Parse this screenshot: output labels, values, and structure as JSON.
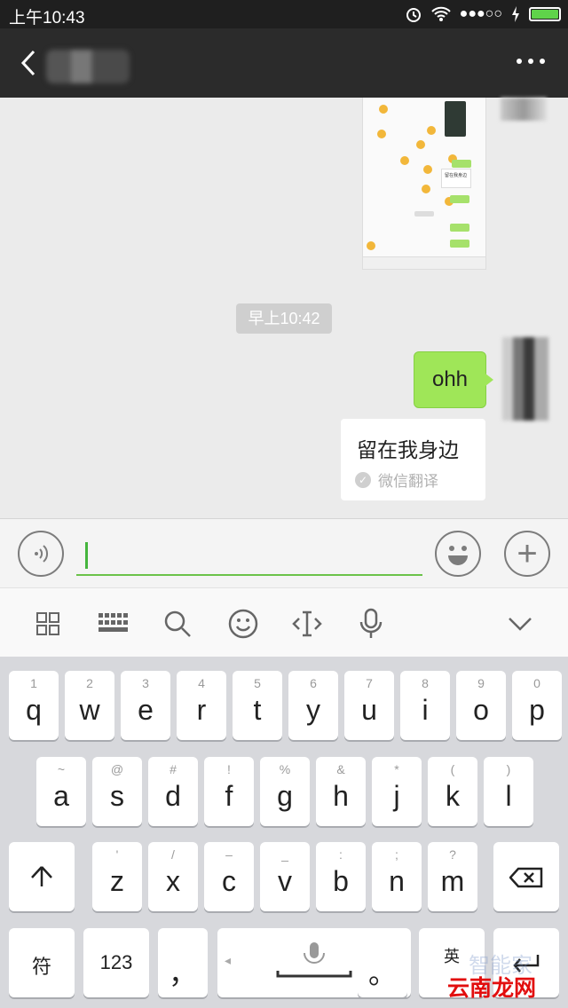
{
  "status_bar": {
    "time": "上午10:43",
    "signal": "●●●○○"
  },
  "nav": {
    "title": ""
  },
  "chat": {
    "timestamp": "早上10:42",
    "sent_message": "ohh",
    "translation_text": "留在我身边",
    "translation_source": "微信翻译",
    "thumb_card_text": "留在我身边"
  },
  "input": {
    "value": "",
    "plus_glyph": "+"
  },
  "keyboard": {
    "row1": [
      {
        "sup": "1",
        "main": "q"
      },
      {
        "sup": "2",
        "main": "w"
      },
      {
        "sup": "3",
        "main": "e"
      },
      {
        "sup": "4",
        "main": "r"
      },
      {
        "sup": "5",
        "main": "t"
      },
      {
        "sup": "6",
        "main": "y"
      },
      {
        "sup": "7",
        "main": "u"
      },
      {
        "sup": "8",
        "main": "i"
      },
      {
        "sup": "9",
        "main": "o"
      },
      {
        "sup": "0",
        "main": "p"
      }
    ],
    "row2": [
      {
        "sup": "~",
        "main": "a"
      },
      {
        "sup": "@",
        "main": "s"
      },
      {
        "sup": "#",
        "main": "d"
      },
      {
        "sup": "!",
        "main": "f"
      },
      {
        "sup": "%",
        "main": "g"
      },
      {
        "sup": "&",
        "main": "h"
      },
      {
        "sup": "*",
        "main": "j"
      },
      {
        "sup": "(",
        "main": "k"
      },
      {
        "sup": ")",
        "main": "l"
      }
    ],
    "row3": [
      {
        "sup": "'",
        "main": "z"
      },
      {
        "sup": "/",
        "main": "x"
      },
      {
        "sup": "–",
        "main": "c"
      },
      {
        "sup": "_",
        "main": "v"
      },
      {
        "sup": ":",
        "main": "b"
      },
      {
        "sup": ";",
        "main": "n"
      },
      {
        "sup": "?",
        "main": "m"
      }
    ],
    "symbols_key": "符",
    "numbers_key": "123",
    "comma_key": "，",
    "period_key": "。",
    "lang_key": "英",
    "space_left": "◂",
    "space_right": "▸"
  },
  "watermark": {
    "text": "云南龙网",
    "faint": "智能家"
  }
}
